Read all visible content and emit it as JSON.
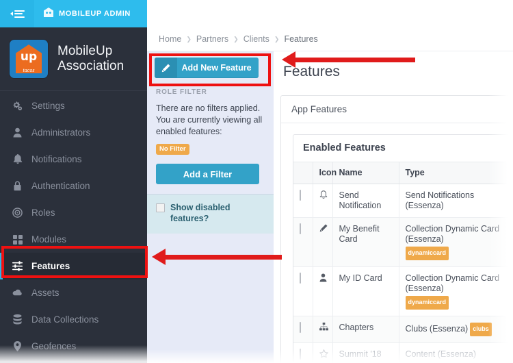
{
  "topbar": {
    "collapse_icon": "menu-collapse-icon",
    "brand_icon": "mobileup-mark-icon",
    "brand_label": "MOBILEUP ADMIN"
  },
  "sidebar": {
    "logo_word": "up",
    "logo_script": "tacos",
    "org_name_line1": "MobileUp",
    "org_name_line2": "Association",
    "items": [
      {
        "label": "Settings",
        "icon": "gears-icon",
        "active": false
      },
      {
        "label": "Administrators",
        "icon": "user-icon",
        "active": false
      },
      {
        "label": "Notifications",
        "icon": "bell-icon",
        "active": false
      },
      {
        "label": "Authentication",
        "icon": "lock-icon",
        "active": false
      },
      {
        "label": "Roles",
        "icon": "target-icon",
        "active": false
      },
      {
        "label": "Modules",
        "icon": "grid-icon",
        "active": false
      },
      {
        "label": "Features",
        "icon": "sliders-icon",
        "active": true
      },
      {
        "label": "Assets",
        "icon": "cloud-icon",
        "active": false
      },
      {
        "label": "Data Collections",
        "icon": "database-icon",
        "active": false
      },
      {
        "label": "Geofences",
        "icon": "map-pin-icon",
        "active": false
      }
    ]
  },
  "breadcrumb": {
    "items": [
      "Home",
      "Partners",
      "Clients",
      "Features"
    ],
    "separator": "❯"
  },
  "left_panel": {
    "add_feature_button": "Add New Feature",
    "add_feature_icon": "magic-wand-icon",
    "role_filter_title": "ROLE FILTER",
    "role_filter_text": "There are no filters applied. You are currently viewing all enabled features:",
    "no_filter_badge": "No Filter",
    "add_filter_button": "Add a Filter",
    "show_disabled_label": "Show disabled features?",
    "show_disabled_checked": false
  },
  "content": {
    "page_title": "Features",
    "app_features_panel": "App Features",
    "enabled_features_panel": "Enabled Features",
    "table": {
      "columns": [
        "",
        "Icon",
        "Name",
        "Type"
      ],
      "rows": [
        {
          "icon": "bell-icon",
          "name": "Send Notification",
          "type": "Send Notifications (Essenza)",
          "tag": "",
          "tag_inline": false,
          "checked": false,
          "faded": false
        },
        {
          "icon": "magic-wand-icon",
          "name": "My Benefit Card",
          "type": "Collection Dynamic Card (Essenza)",
          "tag": "dynamiccard",
          "tag_inline": false,
          "checked": false,
          "faded": false
        },
        {
          "icon": "user-icon",
          "name": "My ID Card",
          "type": "Collection Dynamic Card (Essenza)",
          "tag": "dynamiccard",
          "tag_inline": false,
          "checked": false,
          "faded": false
        },
        {
          "icon": "sitemap-icon",
          "name": "Chapters",
          "type": "Clubs (Essenza)",
          "tag": "clubs",
          "tag_inline": true,
          "checked": false,
          "faded": false
        },
        {
          "icon": "star-icon",
          "name": "Summit '18",
          "type": "Content (Essenza)",
          "tag": "",
          "tag_inline": false,
          "checked": false,
          "faded": true
        }
      ]
    }
  },
  "annotations": {
    "accent_red": "#e01b1b",
    "highlight_boxes": [
      "add-new-feature-button",
      "sidebar-item-features"
    ],
    "arrows": [
      "arrow-to-add-new-feature",
      "arrow-to-sidebar-features"
    ]
  },
  "colors": {
    "topbar_blue": "#2ebced",
    "sidebar_dark": "#2b303b",
    "active_blue": "#29b6e8",
    "button_blue": "#33a2c8",
    "badge_orange": "#efa94a",
    "filter_panel_bg": "#e6eaf7",
    "disabled_panel_bg": "#d6e9ef"
  }
}
